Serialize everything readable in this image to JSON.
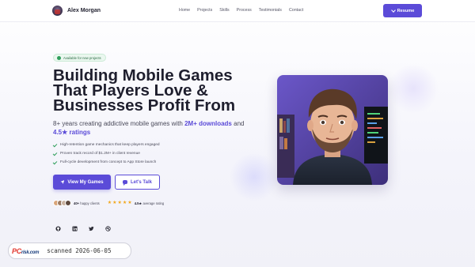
{
  "nav": {
    "brand_name": "Alex Morgan",
    "links": [
      "Home",
      "Projects",
      "Skills",
      "Process",
      "Testimonials",
      "Contact"
    ],
    "resume_label": "Resume"
  },
  "hero": {
    "badge": "Available for new projects",
    "headline_1": "Building Mobile Games",
    "headline_2": "That Players Love &",
    "headline_3": "Businesses Profit From",
    "sub_1": "8+ years creating addictive mobile games with ",
    "sub_highlight_1": "2M+ downloads",
    "sub_2": " and",
    "sub_highlight_2": "4.5★ ratings",
    "features": [
      "High-retention game mechanics that keep players engaged",
      "Proven track record of $1.2M+ in client revenue",
      "Full-cycle development from concept to App Store launch"
    ],
    "primary_cta": "View My Games",
    "secondary_cta": "Let's Talk",
    "clients_count": "40+",
    "clients_label": "happy clients",
    "rating_value": "4.5★",
    "rating_label": "average rating",
    "stars": 5
  },
  "socials": [
    "github-icon",
    "linkedin-icon",
    "twitter-icon",
    "dribbble-icon"
  ],
  "colors": {
    "accent": "#5b4bd8",
    "success": "#2e9e5b",
    "star": "#f2a71b"
  },
  "watermark": {
    "logo_main": "PC",
    "logo_sub": "risk.com",
    "text": "scanned 2026-06-05"
  }
}
